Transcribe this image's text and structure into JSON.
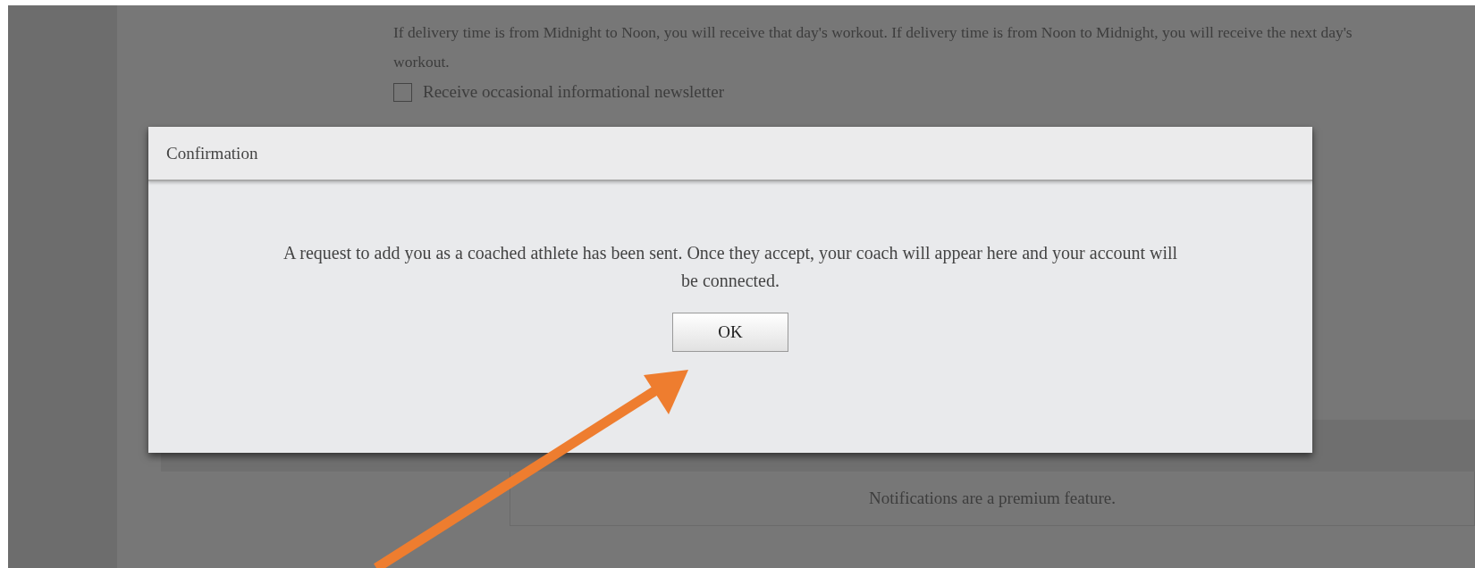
{
  "page": {
    "delivery_note": "If delivery time is from Midnight to Noon, you will receive that day's workout. If delivery time is from Noon to Midnight, you will receive the next day's workout.",
    "newsletter": {
      "label": "Receive occasional informational newsletter",
      "checked": false
    },
    "notifications_note": "Notifications are a premium feature."
  },
  "dialog": {
    "title": "Confirmation",
    "message": "A request to add you as a coached athlete has been sent. Once they accept, your coach will appear here and your account will be connected.",
    "buttons": [
      "OK"
    ]
  }
}
